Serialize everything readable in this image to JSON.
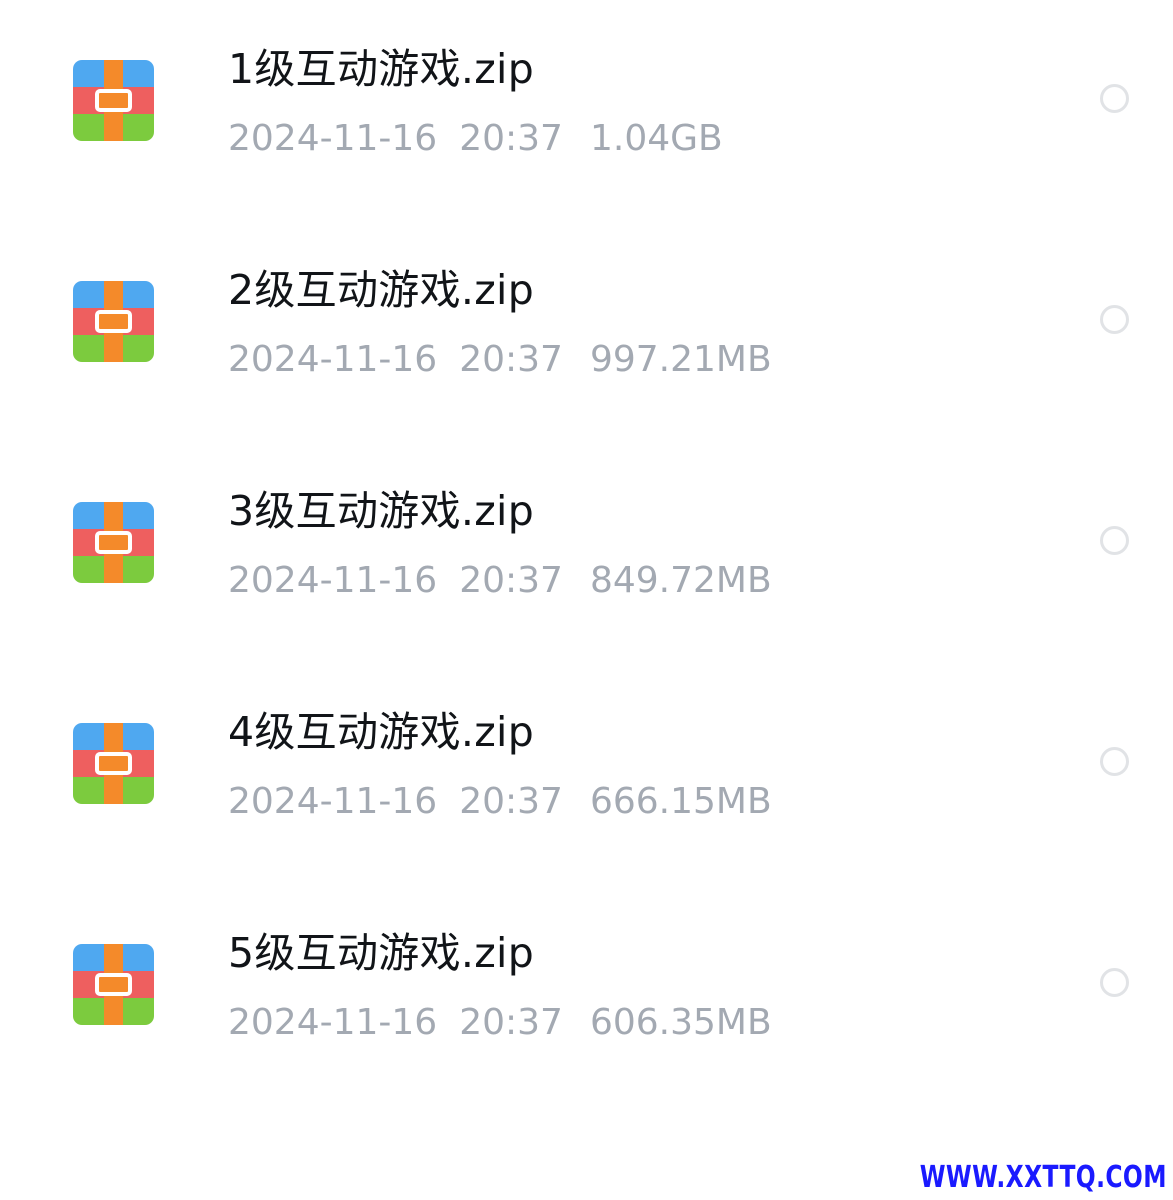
{
  "files": [
    {
      "name": "1级互动游戏.zip",
      "date": "2024-11-16",
      "time": "20:37",
      "size": "1.04GB",
      "icon": "zip-archive-icon",
      "selected": false
    },
    {
      "name": "2级互动游戏.zip",
      "date": "2024-11-16",
      "time": "20:37",
      "size": "997.21MB",
      "icon": "zip-archive-icon",
      "selected": false
    },
    {
      "name": "3级互动游戏.zip",
      "date": "2024-11-16",
      "time": "20:37",
      "size": "849.72MB",
      "icon": "zip-archive-icon",
      "selected": false
    },
    {
      "name": "4级互动游戏.zip",
      "date": "2024-11-16",
      "time": "20:37",
      "size": "666.15MB",
      "icon": "zip-archive-icon",
      "selected": false
    },
    {
      "name": "5级互动游戏.zip",
      "date": "2024-11-16",
      "time": "20:37",
      "size": "606.35MB",
      "icon": "zip-archive-icon",
      "selected": false
    }
  ],
  "watermark": "WWW.XXTTQ.COM",
  "colors": {
    "name_text": "#111418",
    "meta_text": "#a3a9b2",
    "radio_border": "#e1e3e6",
    "watermark": "#1a1aff",
    "icon_top": "#4fa8f0",
    "icon_middle": "#ee5f5f",
    "icon_bottom": "#7ccb3e",
    "icon_strap": "#f48a2a"
  }
}
